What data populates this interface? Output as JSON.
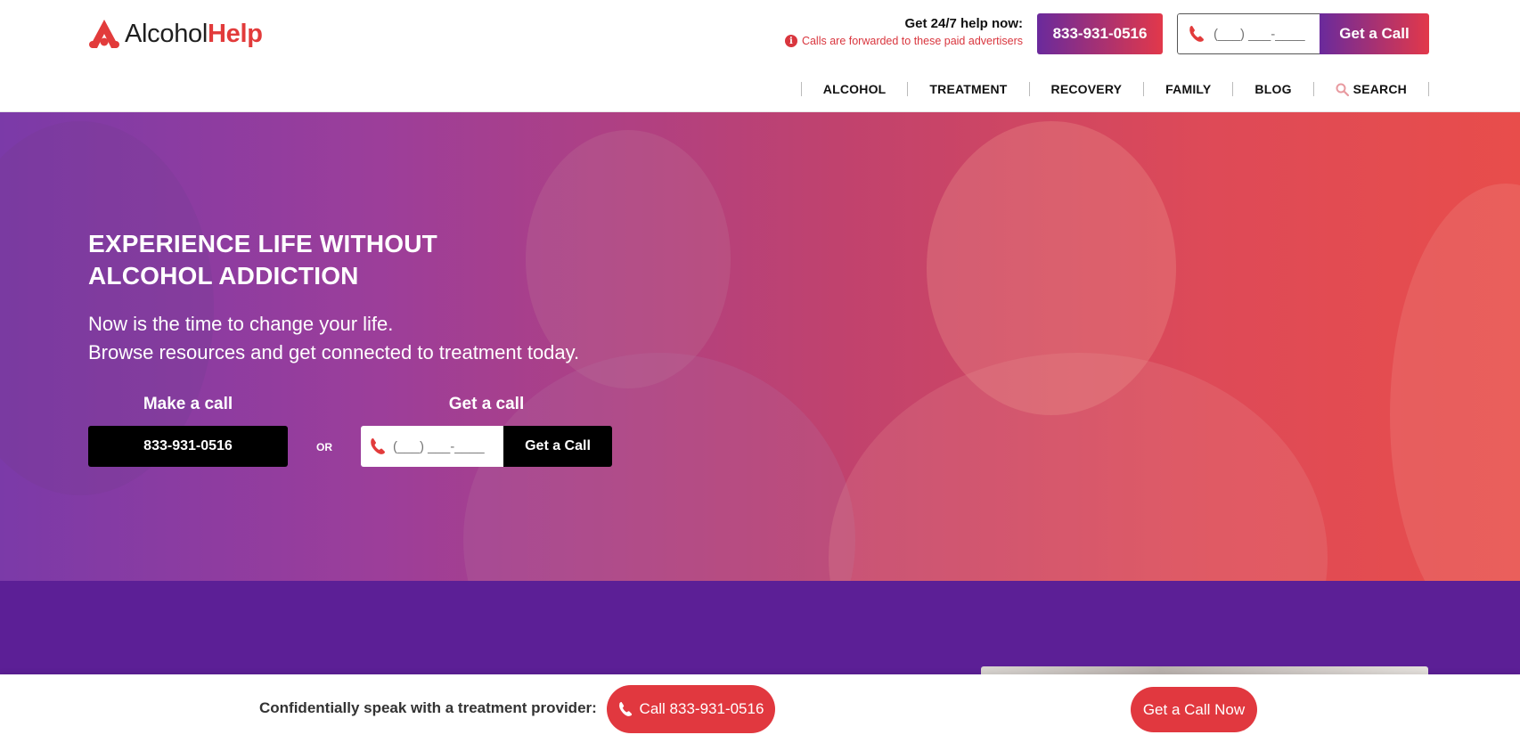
{
  "header": {
    "logo": {
      "part1": "Alcohol",
      "part2": "Help"
    },
    "help_title": "Get 24/7 help now:",
    "help_note": "Calls are forwarded to these paid advertisers",
    "phone": "833-931-0516",
    "callback": {
      "placeholder": "(___) ___-____",
      "button_label": "Get a Call"
    }
  },
  "nav": {
    "items": [
      {
        "label": "ALCOHOL"
      },
      {
        "label": "TREATMENT"
      },
      {
        "label": "RECOVERY"
      },
      {
        "label": "FAMILY"
      },
      {
        "label": "BLOG"
      },
      {
        "label": "SEARCH",
        "icon": "search-icon"
      }
    ]
  },
  "hero": {
    "title_line1": "EXPERIENCE LIFE WITHOUT",
    "title_line2": "ALCOHOL ADDICTION",
    "subtitle_line1": "Now is the time to change your life.",
    "subtitle_line2": "Browse resources and get connected to treatment today.",
    "make_call_label": "Make a call",
    "phone": "833-931-0516",
    "or_label": "OR",
    "get_call_label": "Get a call",
    "callback": {
      "placeholder": "(___) ___-____",
      "button_label": "Get a Call"
    }
  },
  "sticky": {
    "text": "Confidentially speak with a treatment provider:",
    "call_button": "Call 833-931-0516",
    "get_call_button": "Get a Call Now"
  },
  "colors": {
    "brand_red": "#e1383f",
    "brand_purple": "#5c1f96",
    "gradient_start": "#6a2a9c",
    "gradient_end": "#e2384a"
  }
}
